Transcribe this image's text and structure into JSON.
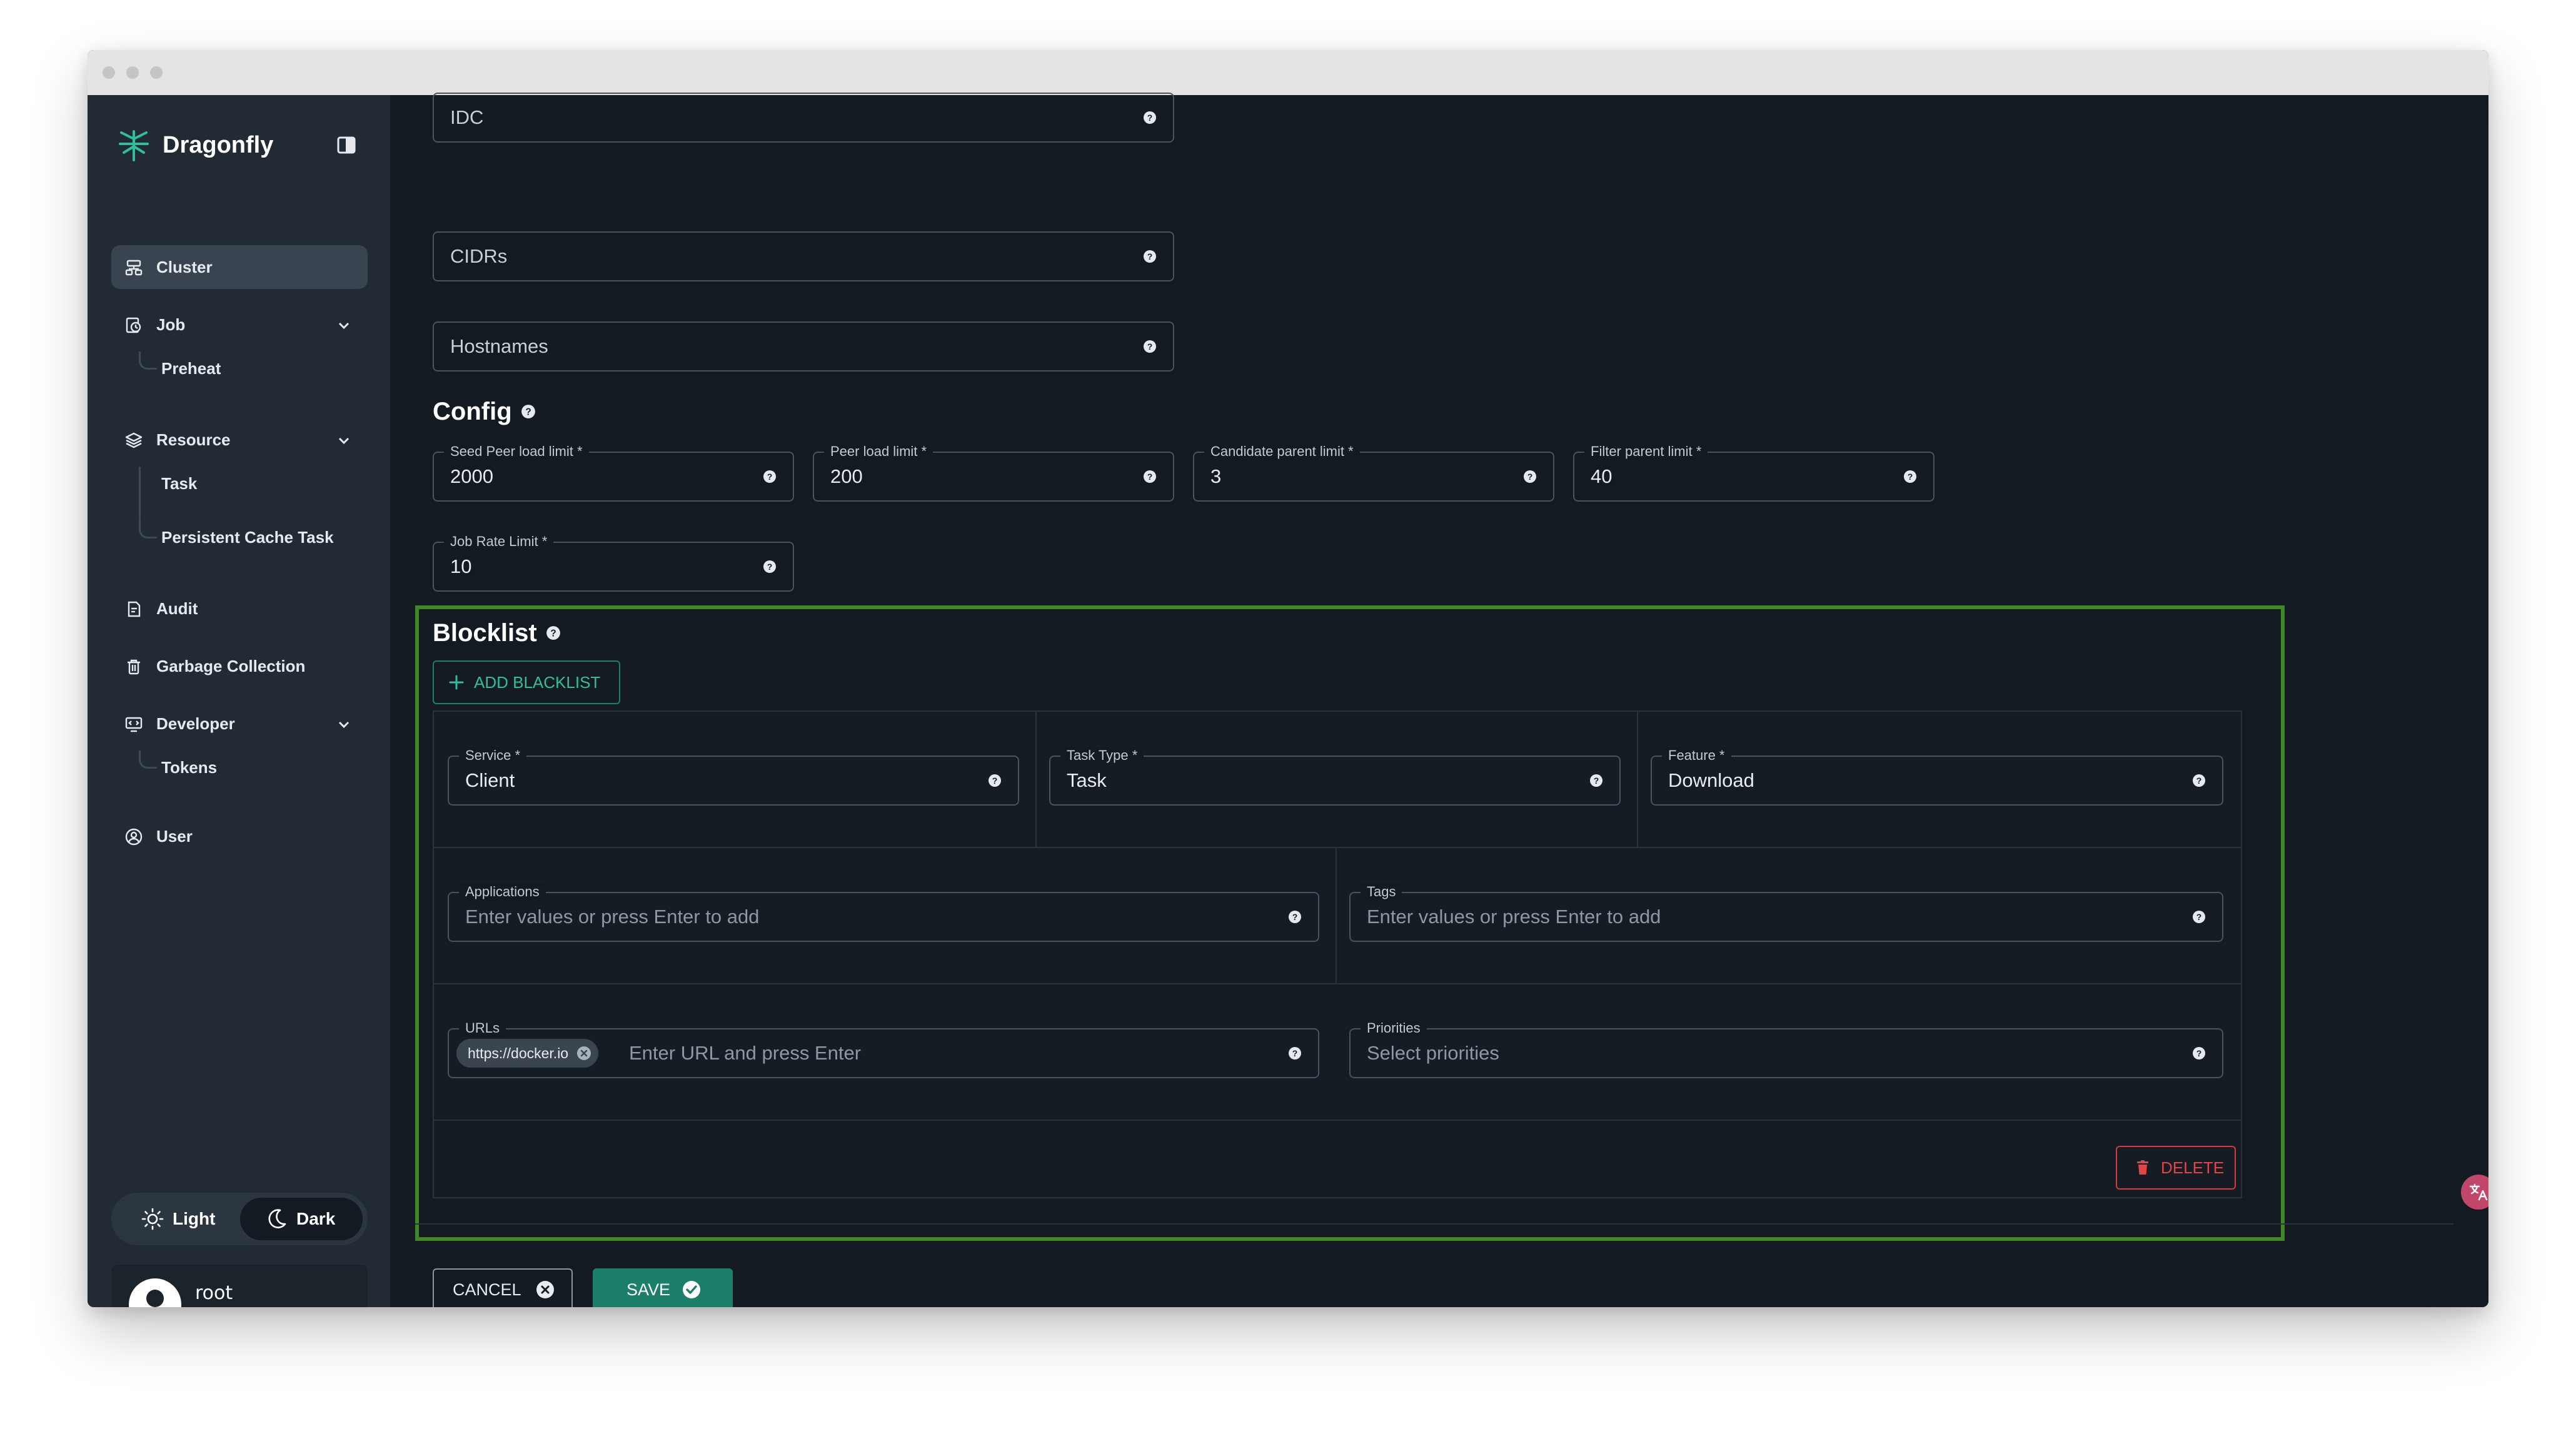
{
  "app": {
    "name": "Dragonfly"
  },
  "colors": {
    "accent": "#1b7f6a",
    "danger": "#e04646",
    "highlight": "#3f8a26",
    "background": "#131a21",
    "sidebar": "#222b34"
  },
  "sidebar": {
    "items": [
      {
        "label": "Cluster",
        "icon": "cluster-icon",
        "active": true
      },
      {
        "label": "Job",
        "icon": "job-icon",
        "expandable": true,
        "children": [
          "Preheat"
        ]
      },
      {
        "label": "Resource",
        "icon": "resource-icon",
        "expandable": true,
        "children": [
          "Task",
          "Persistent Cache Task"
        ]
      },
      {
        "label": "Audit",
        "icon": "audit-icon"
      },
      {
        "label": "Garbage Collection",
        "icon": "trash-icon"
      },
      {
        "label": "Developer",
        "icon": "developer-icon",
        "expandable": true,
        "children": [
          "Tokens"
        ]
      },
      {
        "label": "User",
        "icon": "user-icon"
      }
    ],
    "theme": {
      "light_label": "Light",
      "dark_label": "Dark",
      "selected": "Dark"
    },
    "user": {
      "name": "root",
      "subtitle": "-"
    }
  },
  "form": {
    "scopes": {
      "idc": {
        "value": "IDC"
      },
      "cidrs": {
        "value": "CIDRs"
      },
      "hostnames": {
        "value": "Hostnames"
      }
    },
    "config": {
      "title": "Config",
      "seed_peer_load_limit": {
        "label": "Seed Peer load limit *",
        "value": "2000"
      },
      "peer_load_limit": {
        "label": "Peer load limit *",
        "value": "200"
      },
      "candidate_parent_limit": {
        "label": "Candidate parent limit *",
        "value": "3"
      },
      "filter_parent_limit": {
        "label": "Filter parent limit *",
        "value": "40"
      },
      "job_rate_limit": {
        "label": "Job Rate Limit *",
        "value": "10"
      }
    },
    "blocklist": {
      "title": "Blocklist",
      "add_label": "ADD BLACKLIST",
      "entry": {
        "service": {
          "label": "Service *",
          "value": "Client"
        },
        "task_type": {
          "label": "Task Type *",
          "value": "Task"
        },
        "feature": {
          "label": "Feature *",
          "value": "Download"
        },
        "applications": {
          "label": "Applications",
          "placeholder": "Enter values or press Enter to add"
        },
        "tags": {
          "label": "Tags",
          "placeholder": "Enter values or press Enter to add"
        },
        "urls": {
          "label": "URLs",
          "chips": [
            "https://docker.io"
          ],
          "placeholder": "Enter URL and press Enter"
        },
        "priorities": {
          "label": "Priorities",
          "placeholder": "Select priorities"
        },
        "delete_label": "DELETE"
      }
    },
    "actions": {
      "cancel_label": "CANCEL",
      "save_label": "SAVE"
    }
  }
}
